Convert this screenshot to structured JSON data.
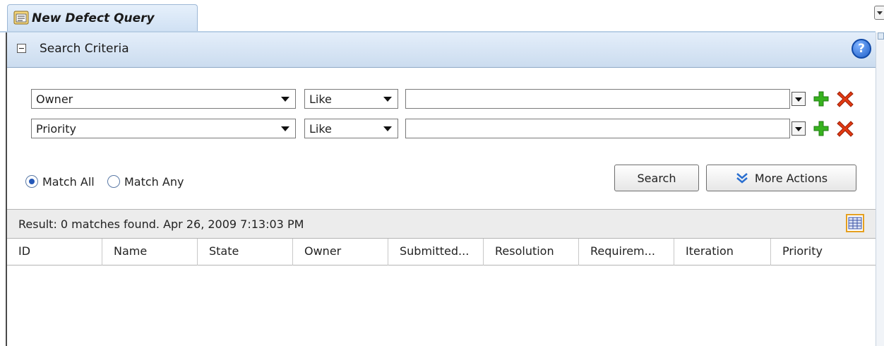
{
  "tab": {
    "title": "New Defect Query",
    "icon": "query-window-icon"
  },
  "criteria": {
    "title": "Search Criteria",
    "rows": [
      {
        "field": "Owner",
        "operator": "Like",
        "value": ""
      },
      {
        "field": "Priority",
        "operator": "Like",
        "value": ""
      }
    ]
  },
  "match": {
    "all_label": "Match All",
    "all_selected": true,
    "any_label": "Match Any",
    "any_selected": false
  },
  "buttons": {
    "search": "Search",
    "more_actions": "More Actions"
  },
  "result": {
    "text": "Result: 0 matches found. Apr 26, 2009 7:13:03 PM"
  },
  "columns": [
    "ID",
    "Name",
    "State",
    "Owner",
    "Submitted...",
    "Resolution",
    "Requirem...",
    "Iteration",
    "Priority"
  ],
  "colors": {
    "header_blue": "#cbdcef",
    "accent_add": "#2ea01a",
    "accent_remove": "#e03010",
    "help_blue": "#1f5fc8"
  }
}
